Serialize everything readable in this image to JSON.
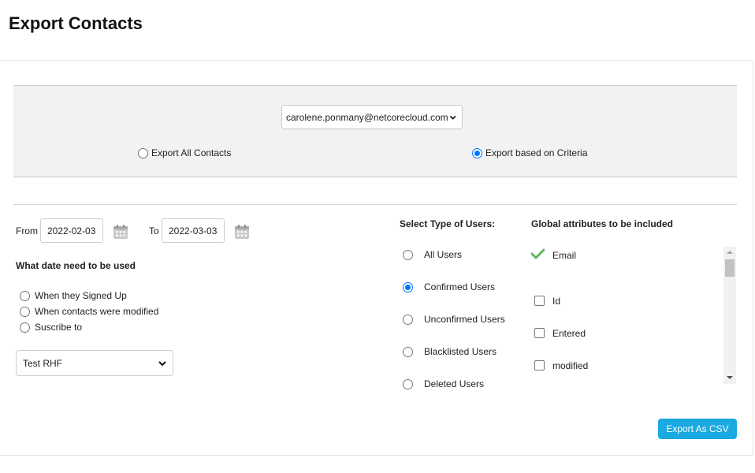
{
  "page": {
    "title": "Export Contacts"
  },
  "account": {
    "selected_email": "carolene.ponmany@netcorecloud.com"
  },
  "export_mode": {
    "options": [
      {
        "label": "Export All Contacts",
        "checked": false
      },
      {
        "label": "Export based on Criteria",
        "checked": true
      }
    ]
  },
  "date_range": {
    "from_label": "From",
    "from_value": "2022-02-03",
    "to_label": "To",
    "to_value": "2022-03-03",
    "calendar_icon": "calendar-icon"
  },
  "date_type": {
    "heading": "What date need to be used",
    "options": [
      {
        "label": "When they Signed Up",
        "checked": false
      },
      {
        "label": "When contacts were modified",
        "checked": false
      },
      {
        "label": "Suscribe to",
        "checked": false
      }
    ]
  },
  "list_select": {
    "selected": "Test RHF"
  },
  "user_types": {
    "heading": "Select Type of Users:",
    "options": [
      {
        "label": "All Users",
        "checked": false
      },
      {
        "label": "Confirmed Users",
        "checked": true
      },
      {
        "label": "Unconfirmed Users",
        "checked": false
      },
      {
        "label": "Blacklisted Users",
        "checked": false
      },
      {
        "label": "Deleted Users",
        "checked": false
      }
    ]
  },
  "attributes": {
    "heading": "Global attributes to be included",
    "items": [
      {
        "label": "Email",
        "state": "locked-checked"
      },
      {
        "label": "Id",
        "state": "unchecked"
      },
      {
        "label": "Entered",
        "state": "unchecked"
      },
      {
        "label": "modified",
        "state": "unchecked"
      }
    ]
  },
  "actions": {
    "export_label": "Export As CSV"
  },
  "colors": {
    "accent": "#1ba9e1",
    "radio_selected": "#0075ff",
    "checkmark": "#5cb85c"
  }
}
